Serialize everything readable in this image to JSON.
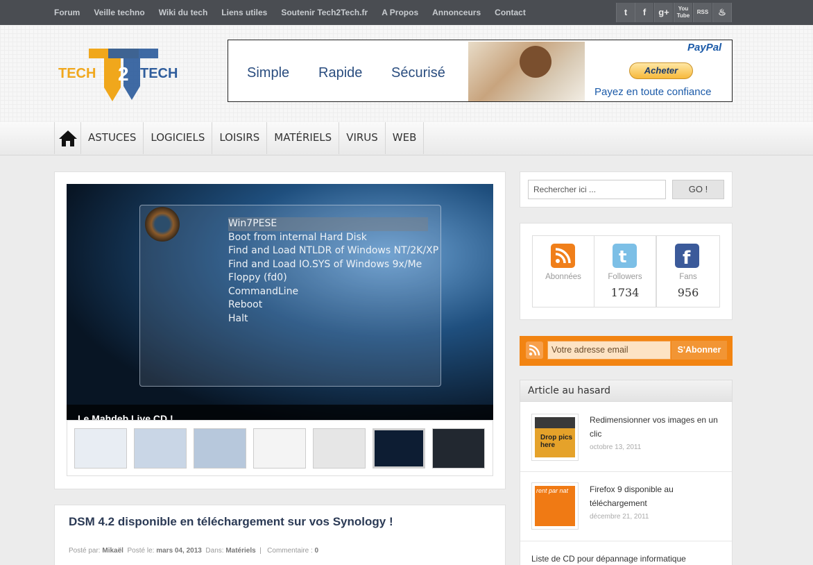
{
  "topnav": {
    "items": [
      "Forum",
      "Veille techno",
      "Wiki du tech",
      "Liens utiles",
      "Soutenir Tech2Tech.fr",
      "A Propos",
      "Annonceurs",
      "Contact"
    ],
    "social": [
      "twitter-icon",
      "facebook-icon",
      "googleplus-icon",
      "youtube-icon",
      "rss-icon",
      "flame-icon"
    ],
    "social_glyphs": [
      "t",
      "f",
      "g+",
      "You Tube",
      "RSS",
      "♨"
    ]
  },
  "logo": {
    "text_left": "TECH",
    "digit": "2",
    "text_right": "TECH"
  },
  "banner": {
    "words": [
      "Simple",
      "Rapide",
      "Sécurisé"
    ],
    "brand": "PayPal",
    "button": "Acheter",
    "tagline": "Payez en toute confiance"
  },
  "nav": {
    "home_icon": "home-icon",
    "items": [
      "ASTUCES",
      "LOGICIELS",
      "LOISIRS",
      "MATÉRIELS",
      "VIRUS",
      "WEB"
    ]
  },
  "slider": {
    "menu": [
      "Win7PESE",
      "Boot from internal Hard Disk",
      "Find and Load NTLDR of Windows NT/2K/XP",
      "Find and Load IO.SYS of Windows 9x/Me",
      "Floppy (fd0)",
      "CommandLine",
      "Reboot",
      "Halt"
    ],
    "caption": "Le Mahdeb Live CD !",
    "thumb_count": 7
  },
  "post": {
    "title": "DSM 4.2 disponible en téléchargement sur vos Synology !",
    "posted_by_label": "Posté par:",
    "author": "Mikaël",
    "posted_on_label": "Posté le:",
    "date": "mars 04, 2013",
    "in_label": "Dans:",
    "category": "Matériels",
    "comments_label": "Commentaire :",
    "comments": "0"
  },
  "search": {
    "placeholder": "Rechercher ici ...",
    "button": "GO !"
  },
  "counters": [
    {
      "icon": "rss-icon",
      "label": "Abonnées",
      "value": ""
    },
    {
      "icon": "twitter-icon",
      "label": "Followers",
      "value": "1734"
    },
    {
      "icon": "facebook-icon",
      "label": "Fans",
      "value": "956"
    }
  ],
  "subscribe": {
    "placeholder": "Votre adresse email",
    "button": "S'Abonner"
  },
  "random": {
    "title": "Article au hasard",
    "items": [
      {
        "title": "Redimensionner vos images en un clic",
        "date": "octobre 13, 2011",
        "thumb_text": "Drop pics here"
      },
      {
        "title": "Firefox 9 disponible au téléchargement",
        "date": "décembre 21, 2011",
        "thumb_text": "rent par nat"
      },
      {
        "title": "Liste de CD pour dépannage informatique",
        "date": ""
      }
    ]
  },
  "colors": {
    "topbar": "#4a4d52",
    "accent_orange": "#f28412",
    "link_blue": "#2b3a55"
  }
}
